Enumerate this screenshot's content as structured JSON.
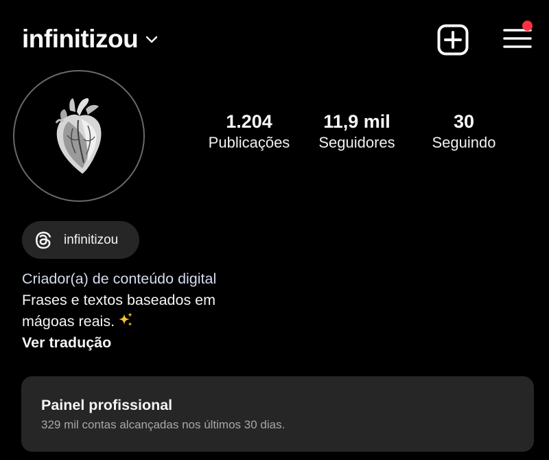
{
  "header": {
    "username": "infinitizou",
    "switch_icon": "chevron-down-icon",
    "create_icon": "plus-square-icon",
    "menu_icon": "hamburger-menu-icon",
    "notification_color": "#ff3040"
  },
  "profile": {
    "avatar_icon": "anatomical-heart-icon",
    "stats": [
      {
        "value": "1.204",
        "label": "Publicações"
      },
      {
        "value": "11,9 mil",
        "label": "Seguidores"
      },
      {
        "value": "30",
        "label": "Seguindo"
      }
    ]
  },
  "threads": {
    "icon": "threads-icon",
    "handle": "infinitizou"
  },
  "bio": {
    "category": "Criador(a) de conteúdo digital",
    "line1": "Frases e textos baseados em",
    "line2": "mágoas reais.",
    "emoji": "sparkles-icon",
    "translate": "Ver tradução"
  },
  "dashboard": {
    "title": "Painel profissional",
    "subtitle": "329 mil contas alcançadas nos últimos 30 dias."
  }
}
